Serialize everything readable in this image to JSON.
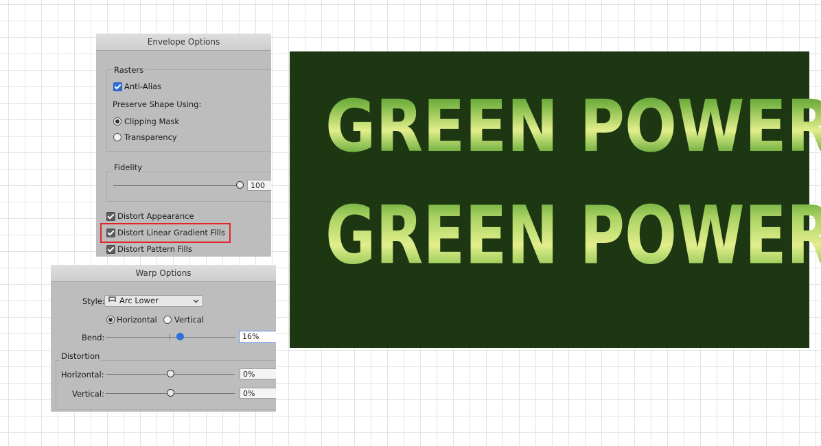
{
  "envelope_options": {
    "title": "Envelope Options",
    "rasters": {
      "group_label": "Rasters",
      "anti_alias_label": "Anti-Alias",
      "anti_alias_checked": true,
      "preserve_shape_label": "Preserve Shape Using:",
      "clipping_mask_label": "Clipping Mask",
      "transparency_label": "Transparency",
      "selected_mode": "Clipping Mask"
    },
    "fidelity": {
      "group_label": "Fidelity",
      "value": "100"
    },
    "distort_appearance_label": "Distort Appearance",
    "distort_linear_gradient_label": "Distort Linear Gradient Fills",
    "distort_pattern_label": "Distort Pattern Fills"
  },
  "warp_options": {
    "title": "Warp Options",
    "style_label": "Style:",
    "style_value": "Arc Lower",
    "horizontal_label": "Horizontal",
    "vertical_label": "Vertical",
    "orientation": "Horizontal",
    "bend_label": "Bend:",
    "bend_value": "16%",
    "distortion": {
      "group_label": "Distortion",
      "horizontal_label": "Horizontal:",
      "horizontal_value": "0%",
      "vertical_label": "Vertical:",
      "vertical_value": "0%"
    }
  },
  "artwork": {
    "text_line_1": "GREEN POWER",
    "text_line_2": "GREEN POWER",
    "background_color": "#1c3712",
    "gradient_light": "#e2ee8c",
    "gradient_dark": "#3f8a24"
  },
  "icons": {
    "style_icon": "shield-arc-icon",
    "dropdown_icon": "chevron-down-icon"
  }
}
